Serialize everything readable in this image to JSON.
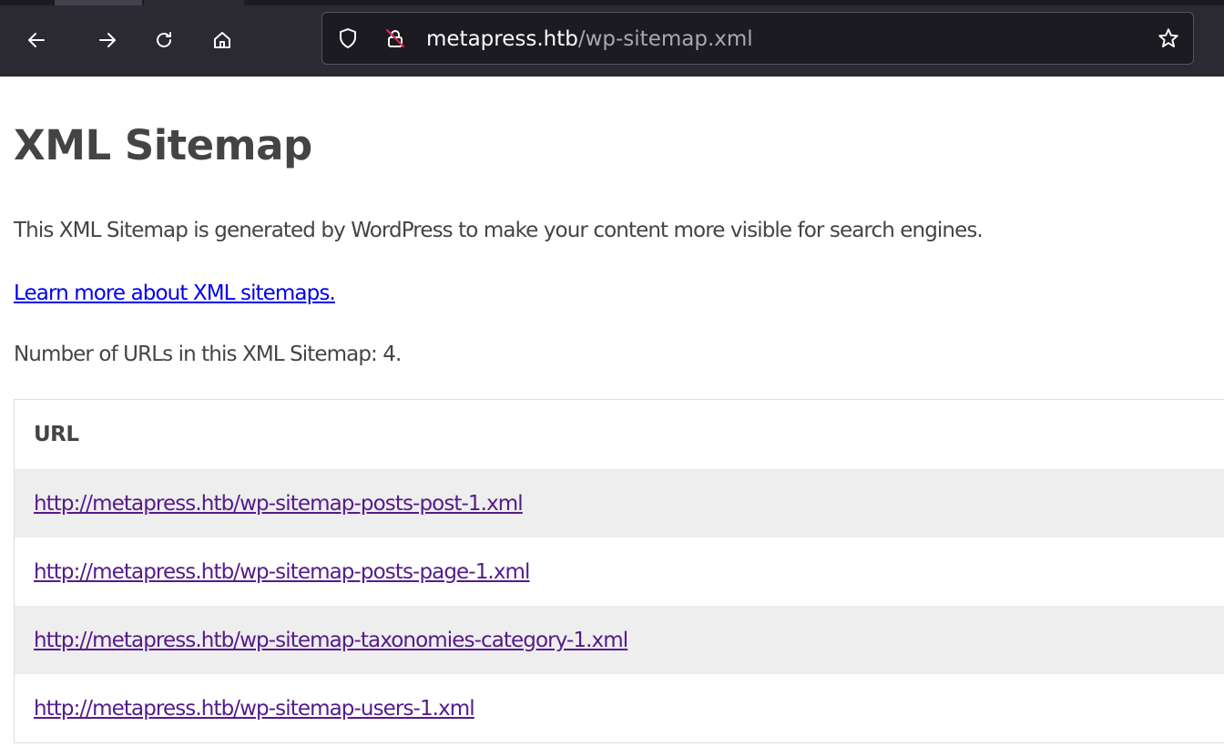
{
  "browser": {
    "url_host": "metapress.htb",
    "url_path": "/wp-sitemap.xml"
  },
  "page": {
    "title": "XML Sitemap",
    "description": "This XML Sitemap is generated by WordPress to make your content more visible for search engines.",
    "learn_more_link": "Learn more about XML sitemaps.",
    "count_text": "Number of URLs in this XML Sitemap: 4."
  },
  "table": {
    "header": "URL",
    "rows": [
      "http://metapress.htb/wp-sitemap-posts-post-1.xml",
      "http://metapress.htb/wp-sitemap-posts-page-1.xml",
      "http://metapress.htb/wp-sitemap-taxonomies-category-1.xml",
      "http://metapress.htb/wp-sitemap-users-1.xml"
    ]
  },
  "icons": {
    "back": "back-arrow-icon",
    "forward": "forward-arrow-icon",
    "reload": "reload-icon",
    "home": "home-icon",
    "tracking": "shield-icon",
    "insecure": "insecure-lock-icon",
    "bookmark": "bookmark-star-icon"
  },
  "colors": {
    "toolbar": "#2b2a33",
    "urlbar": "#1c1b22",
    "link": "#0000ee",
    "visited_link": "#551a8b",
    "text": "#444444",
    "row_shade": "#eeeeee",
    "insecure_slash": "#e22850"
  }
}
